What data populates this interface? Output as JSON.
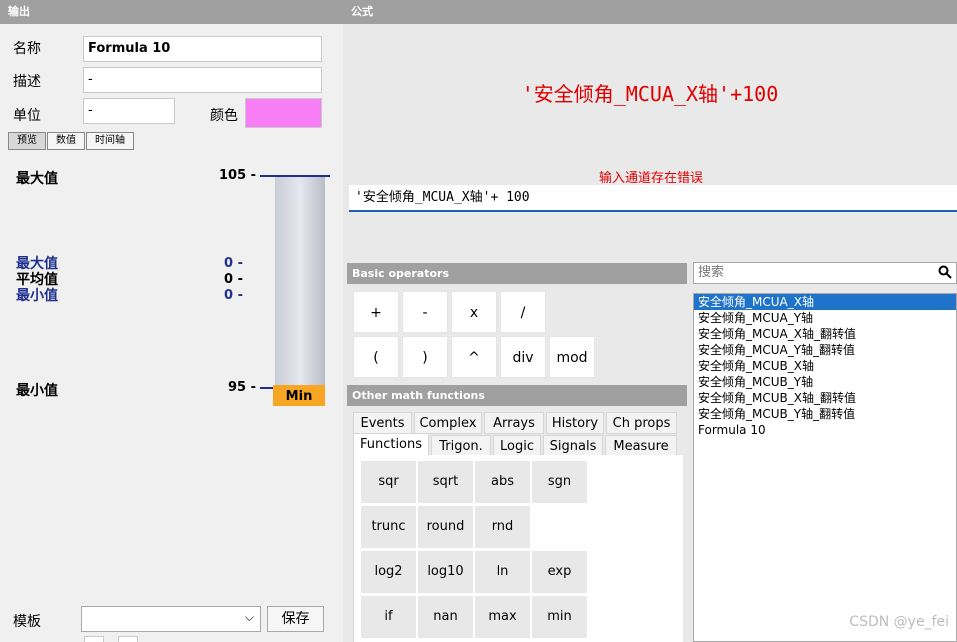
{
  "left": {
    "header": "输出",
    "name_label": "名称",
    "name_value": "Formula 10",
    "desc_label": "描述",
    "desc_value": "-",
    "unit_label": "单位",
    "unit_value": "-",
    "color_label": "颜色",
    "color_value": "#f77ef5",
    "tabs": [
      "预览",
      "数值",
      "时间轴"
    ],
    "max_label": "最大值",
    "max_tick": "105 -",
    "stats": [
      {
        "label": "最大值",
        "value": "0 -"
      },
      {
        "label": "平均值",
        "value": "0 -"
      },
      {
        "label": "最小值",
        "value": "0 -"
      }
    ],
    "min_label": "最小值",
    "min_tick": "95 -",
    "min_badge": "Min",
    "template_label": "模板",
    "save_button": "保存"
  },
  "right": {
    "header": "公式",
    "formula_display": "'安全倾角_MCUA_X轴'+100",
    "error_message": "输入通道存在错误",
    "formula_input": "'安全倾角_MCUA_X轴'+ 100",
    "basic_header": "Basic operators",
    "operators": [
      "+",
      "-",
      "x",
      "/",
      "(",
      ")",
      "^",
      "div",
      "mod"
    ],
    "other_header": "Other math functions",
    "tabs_row1": [
      "Events",
      "Complex",
      "Arrays",
      "History",
      "Ch props"
    ],
    "tabs_row2": [
      "Functions",
      "Trigon.",
      "Logic",
      "Signals",
      "Measure"
    ],
    "functions": [
      "sqr",
      "sqrt",
      "abs",
      "sgn",
      "trunc",
      "round",
      "rnd",
      "log2",
      "log10",
      "ln",
      "exp",
      "if",
      "nan",
      "max",
      "min"
    ],
    "search_placeholder": "搜索",
    "channels": [
      "安全倾角_MCUA_X轴",
      "安全倾角_MCUA_Y轴",
      "安全倾角_MCUA_X轴_翻转值",
      "安全倾角_MCUA_Y轴_翻转值",
      "安全倾角_MCUB_X轴",
      "安全倾角_MCUB_Y轴",
      "安全倾角_MCUB_X轴_翻转值",
      "安全倾角_MCUB_Y轴_翻转值",
      "Formula 10"
    ],
    "selected_channel": "安全倾角_MCUA_X轴"
  },
  "watermark": "CSDN @ye_fei",
  "colors": {
    "error": "#e00000",
    "selection": "#1f73c8",
    "min_badge": "#f6a623",
    "max_line": "#1f2f8f"
  }
}
